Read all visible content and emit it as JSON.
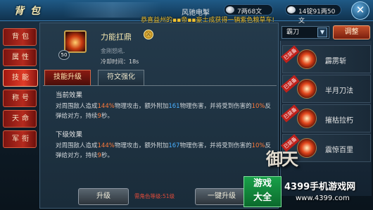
{
  "header": {
    "title": "背 包",
    "character_name": "风驰电掣",
    "currency_silver": "7两68文",
    "currency_gold": "14锭91两50文",
    "close_icon": "close-icon"
  },
  "announcement": "恭喜益州的▪▪帝▪▪豪士成获得一辆紫色粮草车!",
  "left_tabs": [
    {
      "label": "背包"
    },
    {
      "label": "属性"
    },
    {
      "label": "技能"
    },
    {
      "label": "称号"
    },
    {
      "label": "天命"
    },
    {
      "label": "军衔"
    }
  ],
  "skill": {
    "name": "力能扛鼎",
    "level": "50",
    "subtitle": "金刚怒吼.",
    "cooldown": "冷却时间：18s",
    "type_icon": "sword-icon"
  },
  "sub_tabs": {
    "upgrade": "技能升级",
    "rune": "符文强化"
  },
  "current_effect": {
    "title": "当前效果",
    "text_parts": [
      "对周围敌人造成",
      "144%",
      "物理攻击，额外附加",
      "161",
      "物理伤害，并将受到伤害的",
      "10%",
      "反弹给对方，持续",
      "9",
      "秒。"
    ]
  },
  "next_effect": {
    "title": "下级效果",
    "text_parts": [
      "对周围敌人造成",
      "144%",
      "物理攻击，额外附加",
      "167",
      "物理伤害，并将受到伤害的",
      "10%",
      "反弹给对方，持续",
      "9",
      "秒。"
    ]
  },
  "buttons": {
    "upgrade": "升级",
    "requirement": "需角色等级:51级",
    "one_click": "一键升级"
  },
  "weapon": {
    "selected": "霸刀",
    "swap_label": "调整"
  },
  "skill_list": [
    {
      "name": "霹雳斩",
      "equipped": "已装备"
    },
    {
      "name": "半月刀法",
      "equipped": "已装备"
    },
    {
      "name": "摧枯拉朽",
      "equipped": "已装备"
    },
    {
      "name": "震惊百里",
      "equipped": "已装备"
    }
  ],
  "watermark": {
    "logo": "御天",
    "badge_line1": "游戏",
    "badge_line2": "大全",
    "site": "4399手机游戏网",
    "url": "www.4399.com"
  }
}
